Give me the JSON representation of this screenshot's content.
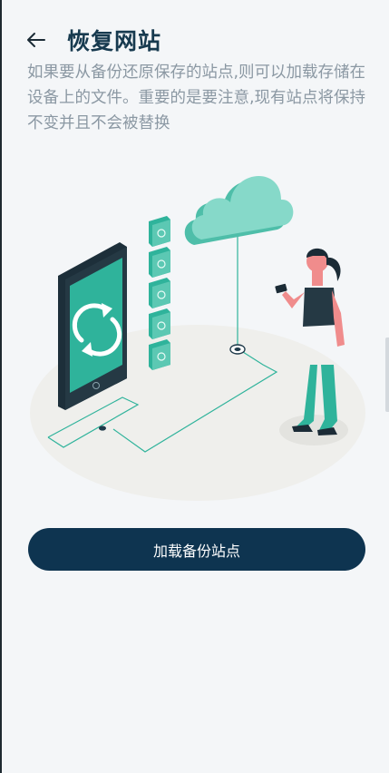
{
  "header": {
    "title": "恢复网站",
    "back_icon": "arrow-left-icon"
  },
  "description": "如果要从备份还原保存的站点,则可以加载存储在设备上的文件。重要的是要注意,现有站点将保持不变并且不会被替换",
  "illustration": {
    "name": "cloud-restore-illustration"
  },
  "actions": {
    "load_backup_label": "加载备份站点"
  },
  "colors": {
    "accent": "#2fb39b",
    "button": "#0e3450",
    "title": "#173a4f",
    "text_muted": "#8b98a3",
    "background": "#f4f6f8"
  }
}
